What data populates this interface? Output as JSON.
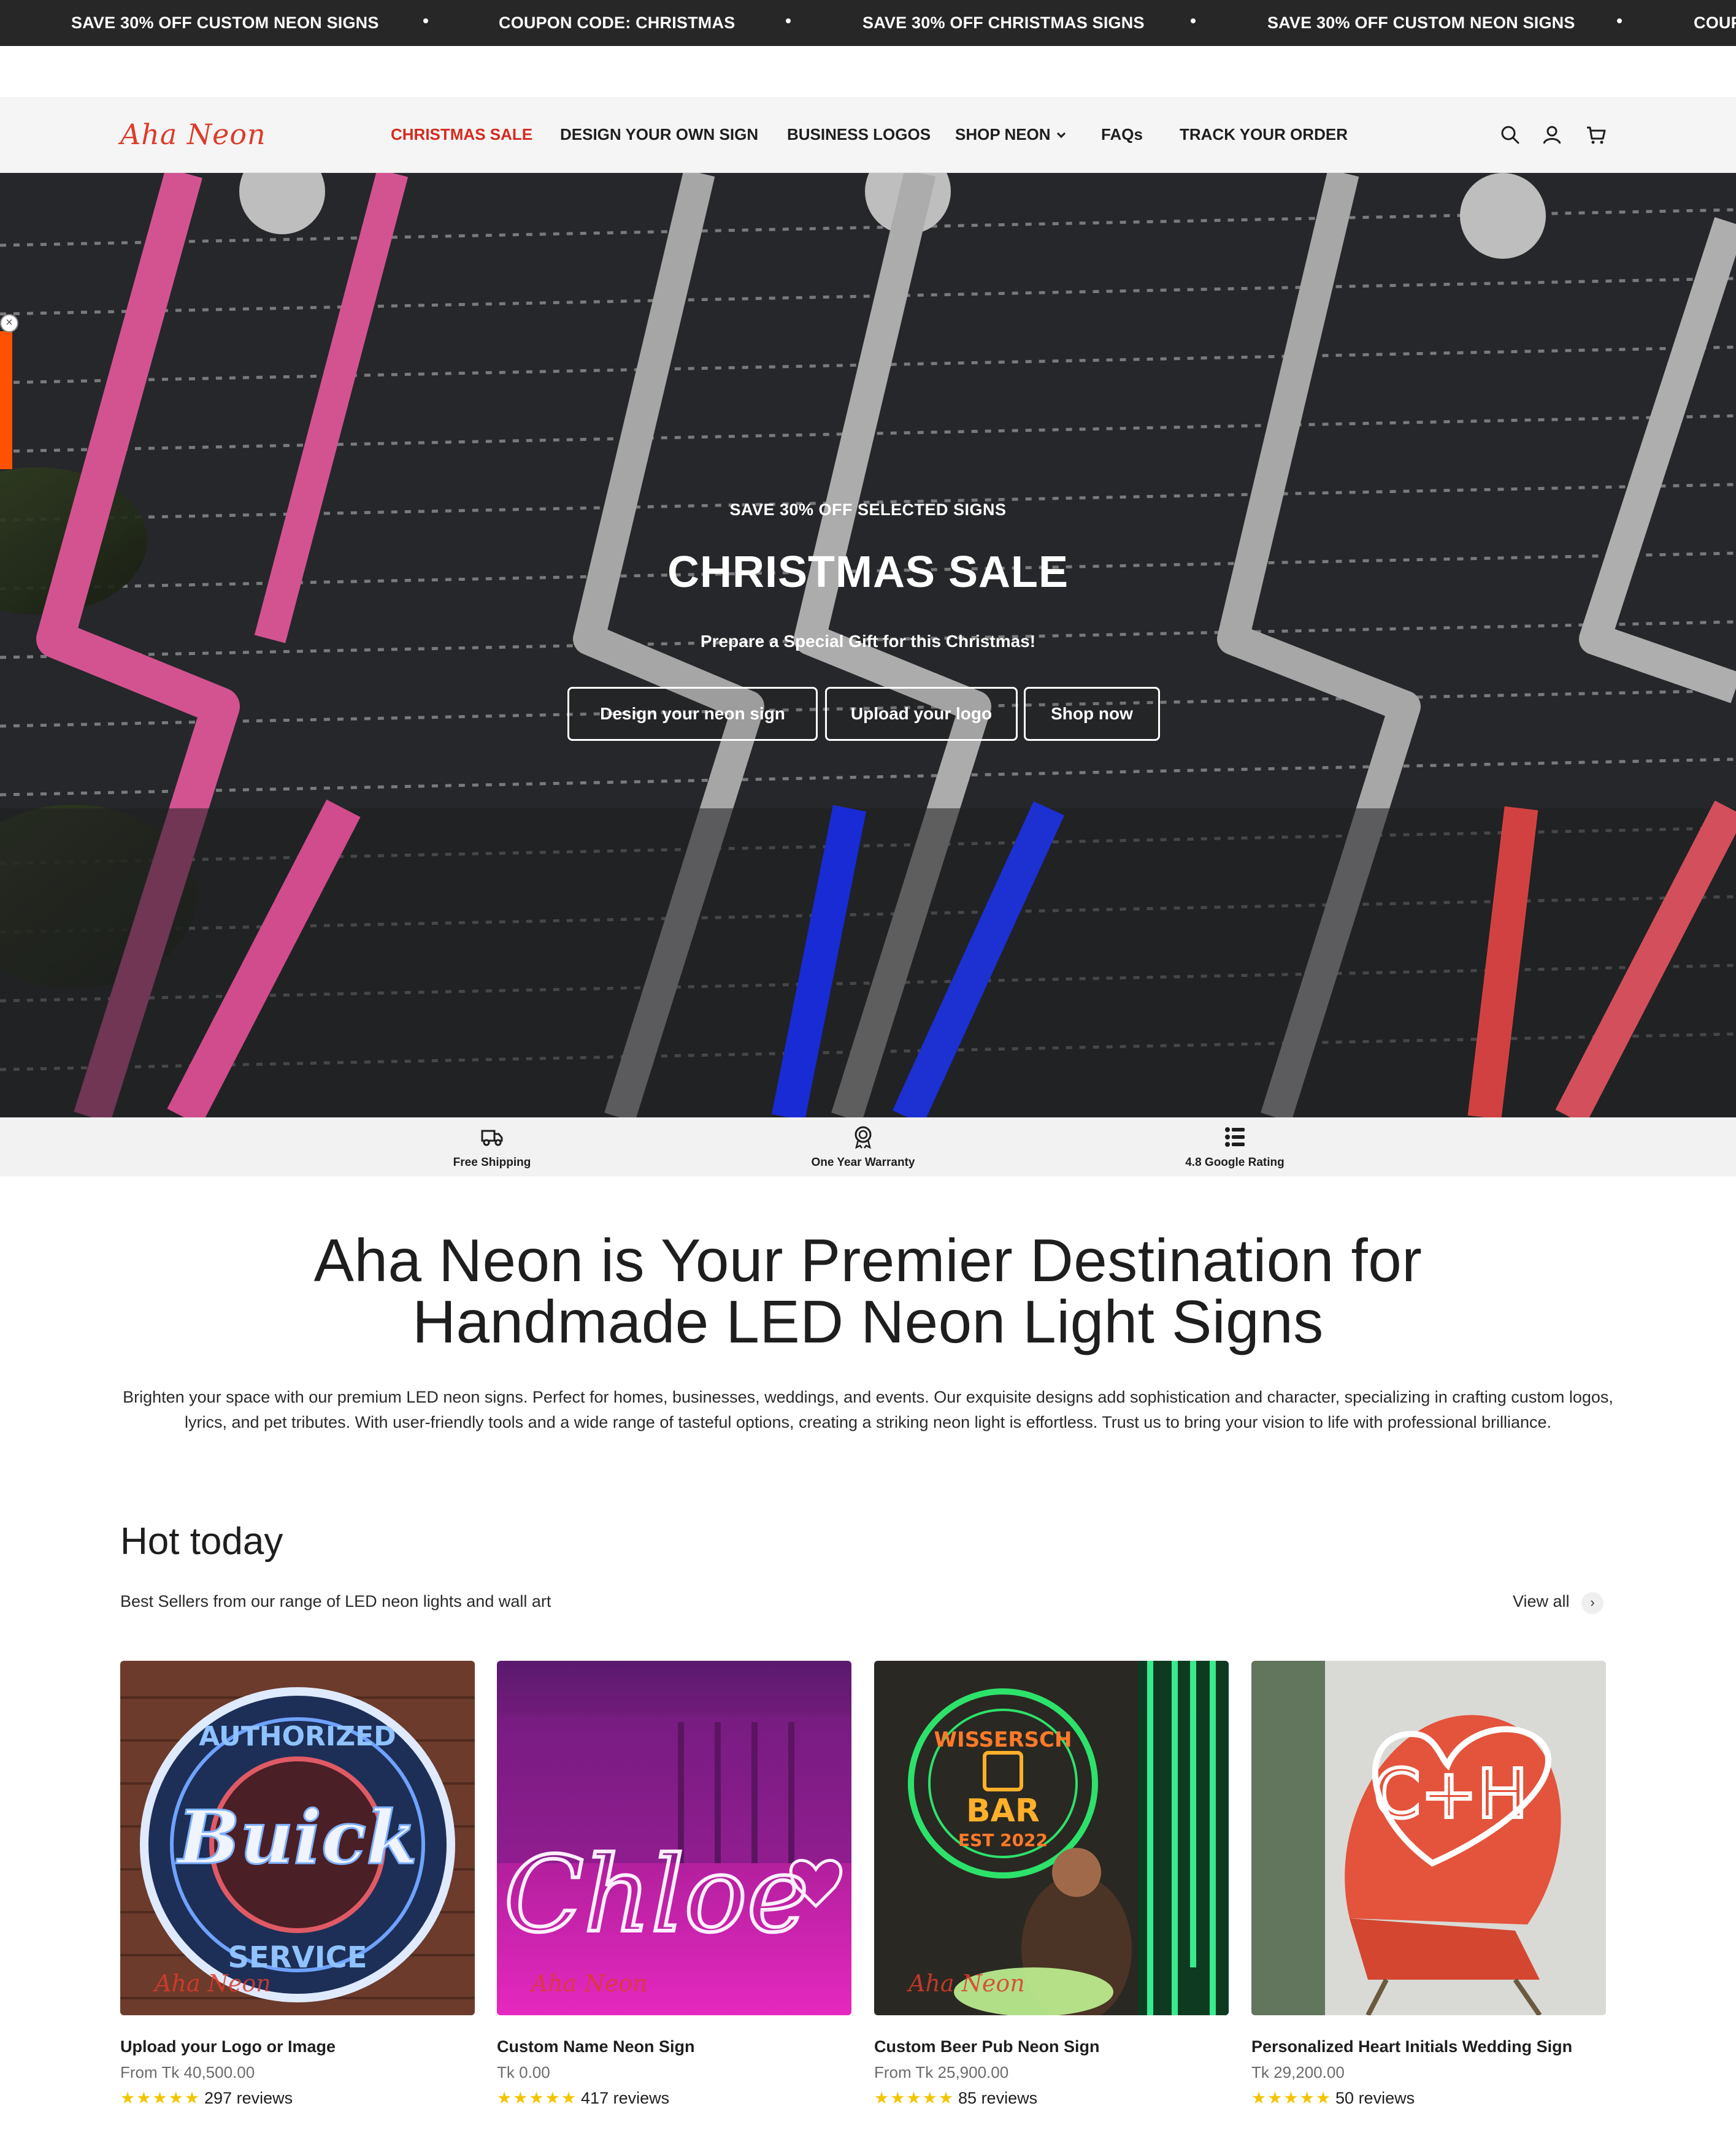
{
  "announcement": {
    "items": [
      "SAVE 30% OFF CUSTOM NEON SIGNS",
      "COUPON CODE: CHRISTMAS",
      "SAVE 30% OFF CHRISTMAS SIGNS",
      "SAVE 30% OFF CUSTOM NEON SIGNS",
      "COUP"
    ]
  },
  "header": {
    "logo": "Aha Neon",
    "nav": [
      {
        "label": "CHRISTMAS SALE"
      },
      {
        "label": "DESIGN YOUR OWN SIGN"
      },
      {
        "label": "BUSINESS LOGOS"
      },
      {
        "label": "SHOP NEON"
      },
      {
        "label": "FAQs"
      },
      {
        "label": "TRACK YOUR ORDER"
      }
    ],
    "icons": [
      "search-icon",
      "account-icon",
      "cart-icon"
    ]
  },
  "hero": {
    "eyebrow": "SAVE 30% OFF SELECTED SIGNS",
    "title": "CHRISTMAS SALE",
    "subtitle": "Prepare a Special Gift for this Christmas!",
    "buttons": [
      {
        "label": "Design your neon sign"
      },
      {
        "label": "Upload your logo"
      },
      {
        "label": "Shop now"
      }
    ]
  },
  "features": [
    {
      "label": "Free Shipping",
      "icon": "truck-icon"
    },
    {
      "label": "One Year Warranty",
      "icon": "warranty-badge-icon"
    },
    {
      "label": "4.8 Google Rating",
      "icon": "rating-list-icon"
    }
  ],
  "intro": {
    "title_line1": "Aha Neon is Your Premier Destination for",
    "title_line2": "Handmade LED Neon Light Signs",
    "body": "Brighten your space with our premium LED neon signs. Perfect for homes, businesses, weddings, and events. Our exquisite designs add sophistication and character, specializing in crafting custom logos, lyrics, and pet tributes. With user-friendly tools and a wide range of tasteful options, creating a striking neon light is effortless. Trust us to bring your vision to life with professional brilliance."
  },
  "hot_today": {
    "title": "Hot today",
    "subtitle": "Best Sellers from our range of LED neon lights and wall art",
    "view_all": "View all",
    "products": [
      {
        "title": "Upload your Logo or Image",
        "price": "From Tk 40,500.00",
        "reviews": "297 reviews",
        "rating": 5,
        "image_text": "Buick",
        "watermark": "Aha Neon"
      },
      {
        "title": "Custom Name Neon Sign",
        "price": "Tk 0.00",
        "reviews": "417 reviews",
        "rating": 5,
        "image_text": "Chloe",
        "watermark": "Aha Neon"
      },
      {
        "title": "Custom Beer Pub Neon Sign",
        "price": "From Tk 25,900.00",
        "reviews": "85 reviews",
        "rating": 5,
        "image_text": "BAR",
        "watermark": "Aha Neon"
      },
      {
        "title": "Personalized Heart Initials Wedding Sign",
        "price": "Tk 29,200.00",
        "reviews": "50 reviews",
        "rating": 5,
        "image_text": "C+H"
      }
    ]
  },
  "colors": {
    "brand_red": "#dd3b2b",
    "sale_red": "#d52a1e",
    "announcement_bg": "#272727",
    "star": "#f3c500",
    "side_tab": "#ff5200"
  }
}
